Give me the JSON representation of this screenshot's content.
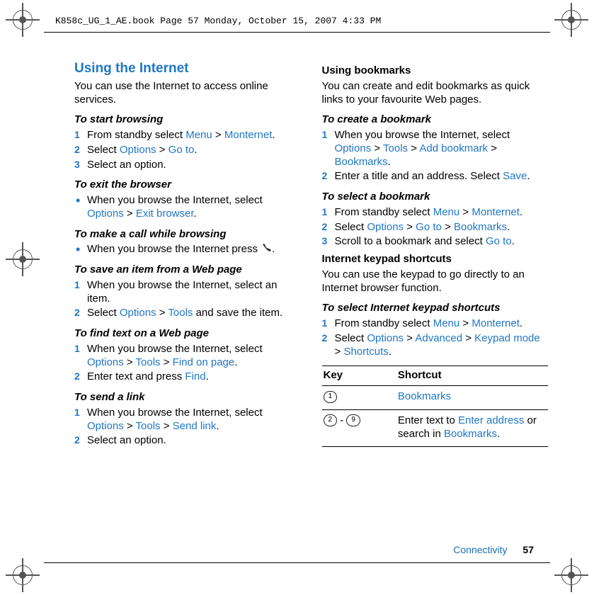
{
  "header": "K858c_UG_1_AE.book  Page 57  Monday, October 15, 2007  4:33 PM",
  "footer": {
    "section": "Connectivity",
    "page": "57"
  },
  "left": {
    "title": "Using the Internet",
    "intro": "You can use the Internet to access online services.",
    "start_browsing_h": "To start browsing",
    "sb1_a": "From standby select ",
    "sb1_menu": "Menu",
    "sb1_gt1": " > ",
    "sb1_monternet": "Monternet",
    "sb1_end": ".",
    "sb2_a": "Select ",
    "sb2_opt": "Options",
    "sb2_gt": " > ",
    "sb2_goto": "Go to",
    "sb2_end": ".",
    "sb3": "Select an option.",
    "exit_h": "To exit the browser",
    "exit_a": "When you browse the Internet, select ",
    "exit_opt": "Options",
    "exit_gt": " > ",
    "exit_cmd": "Exit browser",
    "exit_end": ".",
    "call_h": "To make a call while browsing",
    "call_a": "When you browse the Internet press ",
    "call_end": ".",
    "save_h": "To save an item from a Web page",
    "save1": "When you browse the Internet, select an item.",
    "save2_a": "Select ",
    "save2_opt": "Options",
    "save2_gt": " > ",
    "save2_tools": "Tools",
    "save2_b": " and save the item.",
    "find_h": "To find text on a Web page",
    "find1_a": "When you browse the Internet, select ",
    "find1_opt": "Options",
    "find1_gt1": " > ",
    "find1_tools": "Tools",
    "find1_gt2": " > ",
    "find1_cmd": "Find on page",
    "find1_end": ".",
    "find2_a": "Enter text and press ",
    "find2_cmd": "Find",
    "find2_end": ".",
    "sendlink_h": "To send a link",
    "sl1_a": "When you browse the Internet, select ",
    "sl1_opt": "Options",
    "sl1_gt1": " > ",
    "sl1_tools": "Tools",
    "sl1_gt2": " > ",
    "sl1_cmd": "Send link",
    "sl1_end": ".",
    "sl2": "Select an option."
  },
  "right": {
    "bm_head": "Using bookmarks",
    "bm_intro": "You can create and edit bookmarks as quick links to your favourite Web pages.",
    "create_h": "To create a bookmark",
    "c1_a": "When you browse the Internet, select ",
    "c1_opt": "Options",
    "c1_gt1": " > ",
    "c1_tools": "Tools",
    "c1_gt2": " > ",
    "c1_add": "Add bookmark",
    "c1_gt3": " > ",
    "c1_bk": "Bookmarks",
    "c1_end": ".",
    "c2_a": "Enter a title and an address. Select ",
    "c2_save": "Save",
    "c2_end": ".",
    "select_h": "To select a bookmark",
    "s1_a": "From standby select ",
    "s1_menu": "Menu",
    "s1_gt": " > ",
    "s1_mon": "Monternet",
    "s1_end": ".",
    "s2_a": "Select ",
    "s2_opt": "Options",
    "s2_gt1": " > ",
    "s2_goto": "Go to",
    "s2_gt2": " > ",
    "s2_bk": "Bookmarks",
    "s2_end": ".",
    "s3_a": "Scroll to a bookmark and select ",
    "s3_goto": "Go to",
    "s3_end": ".",
    "short_head": "Internet keypad shortcuts",
    "short_intro": "You can use the keypad to go directly to an Internet browser function.",
    "short_sel_h": "To select Internet keypad shortcuts",
    "ss1_a": "From standby select ",
    "ss1_menu": "Menu",
    "ss1_gt": " > ",
    "ss1_mon": "Monternet",
    "ss1_end": ".",
    "ss2_a": "Select ",
    "ss2_opt": "Options",
    "ss2_gt1": " > ",
    "ss2_adv": "Advanced",
    "ss2_gt2": " > ",
    "ss2_kp": "Keypad mode",
    "ss2_gt3": " > ",
    "ss2_sc": "Shortcuts",
    "ss2_end": ".",
    "table": {
      "h1": "Key",
      "h2": "Shortcut",
      "r1_key": "1",
      "r1_val": "Bookmarks",
      "r2_k1": "2",
      "r2_dash": " - ",
      "r2_k2": "9",
      "r2_a": "Enter text to ",
      "r2_enter": "Enter address",
      "r2_b": " or search in ",
      "r2_bk": "Bookmarks",
      "r2_end": "."
    }
  }
}
